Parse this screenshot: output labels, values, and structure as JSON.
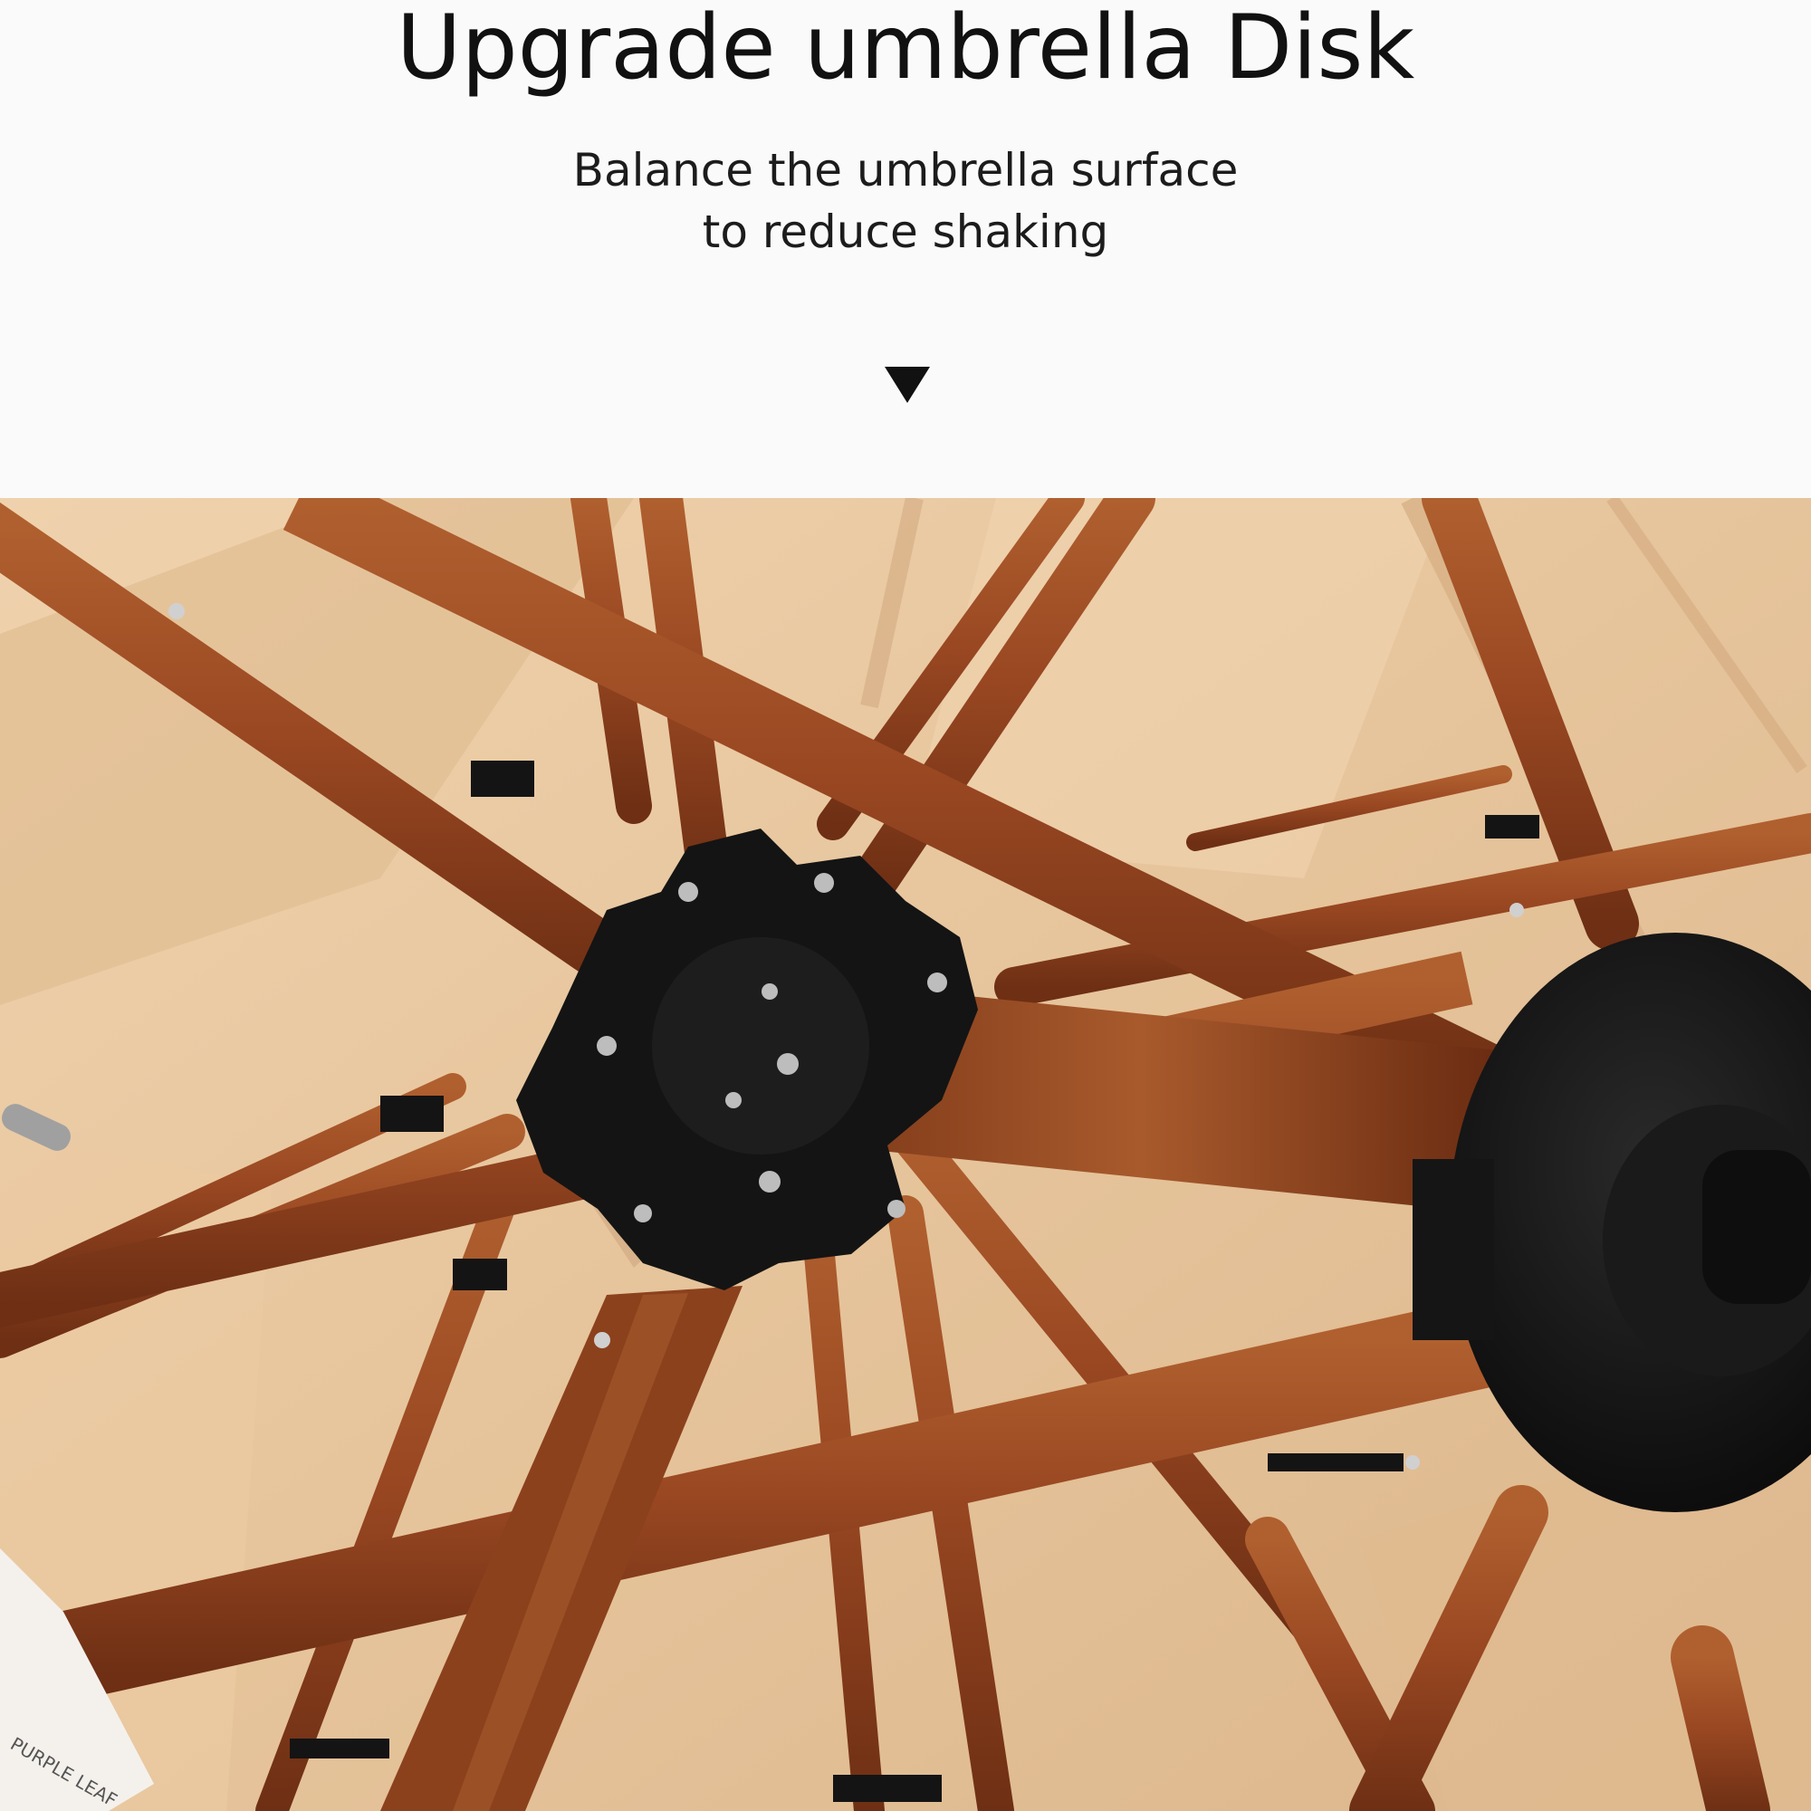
{
  "header": {
    "title": "Upgrade umbrella Disk",
    "subtitle_line1": "Balance the umbrella surface",
    "subtitle_line2": "to reduce shaking",
    "arrow_icon": "triangle-down-icon"
  },
  "photo": {
    "description_icon": "umbrella-hub-photo",
    "logo_text": "PURPLE LEAF"
  },
  "colors": {
    "background": "#fafafa",
    "text": "#111111",
    "canopy": "#e6c49c",
    "wood": "#9b4a22",
    "hub": "#161616"
  }
}
